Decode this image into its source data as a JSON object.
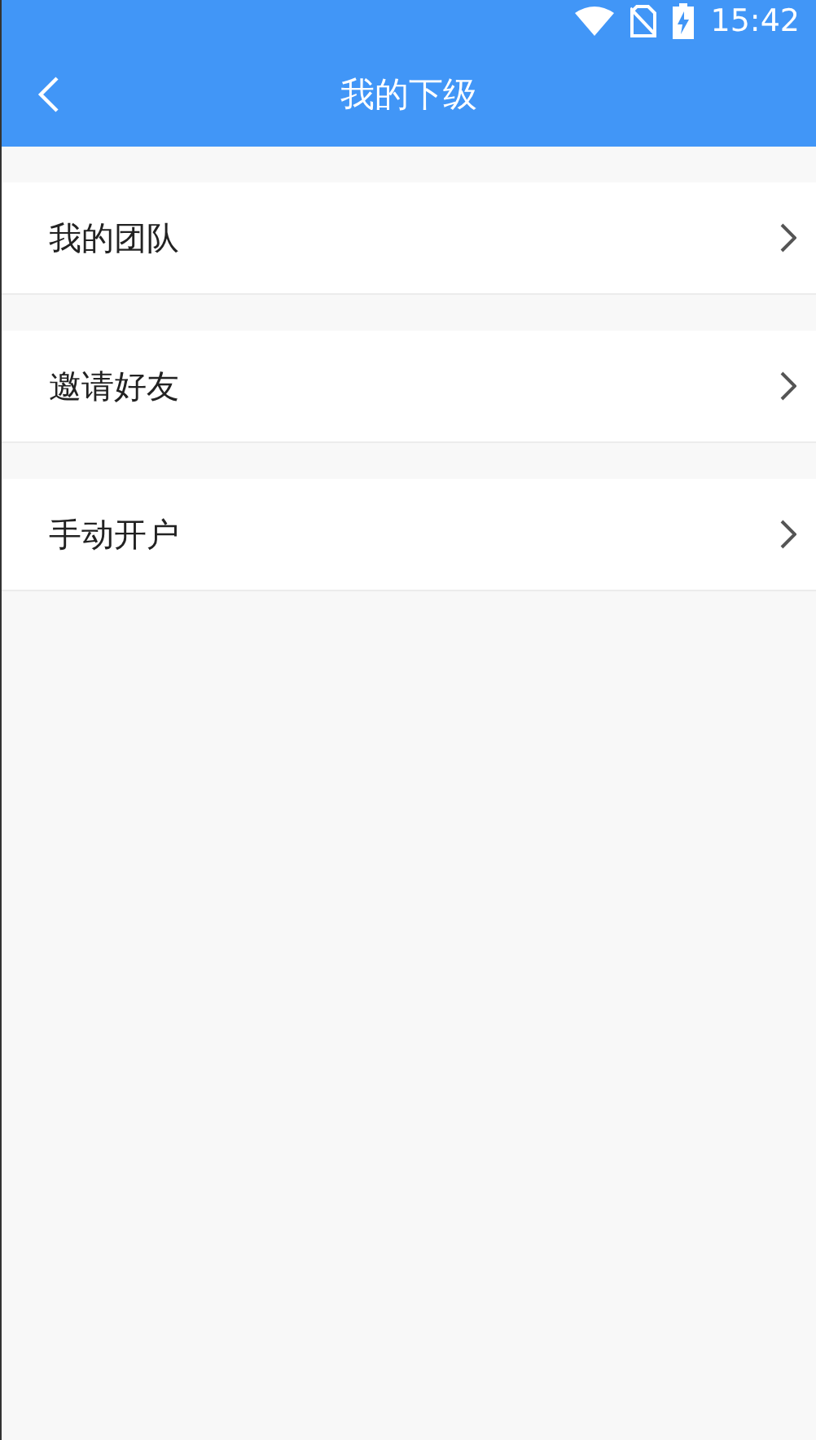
{
  "status_bar": {
    "time": "15:42"
  },
  "header": {
    "title": "我的下级"
  },
  "menu_items": [
    {
      "label": "我的团队"
    },
    {
      "label": "邀请好友"
    },
    {
      "label": "手动开户"
    }
  ]
}
